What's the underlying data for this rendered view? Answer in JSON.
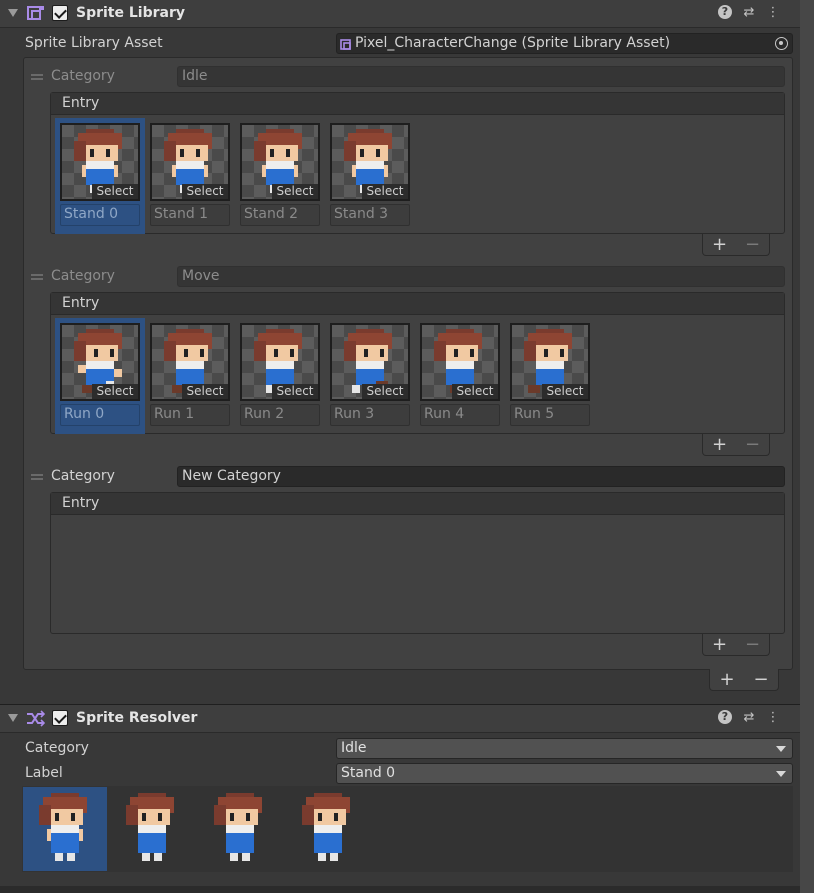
{
  "sprite_library": {
    "title": "Sprite Library",
    "asset_label": "Sprite Library Asset",
    "asset_value": "Pixel_CharacterChange (Sprite Library Asset)",
    "categories": [
      {
        "label": "Category",
        "name": "Idle",
        "entry_header": "Entry",
        "entries": [
          {
            "name": "Stand 0",
            "select": "Select"
          },
          {
            "name": "Stand 1",
            "select": "Select"
          },
          {
            "name": "Stand 2",
            "select": "Select"
          },
          {
            "name": "Stand 3",
            "select": "Select"
          }
        ]
      },
      {
        "label": "Category",
        "name": "Move",
        "entry_header": "Entry",
        "entries": [
          {
            "name": "Run 0",
            "select": "Select"
          },
          {
            "name": "Run 1",
            "select": "Select"
          },
          {
            "name": "Run 2",
            "select": "Select"
          },
          {
            "name": "Run 3",
            "select": "Select"
          },
          {
            "name": "Run 4",
            "select": "Select"
          },
          {
            "name": "Run 5",
            "select": "Select"
          }
        ]
      },
      {
        "label": "Category",
        "name": "New Category",
        "entry_header": "Entry",
        "entries": []
      }
    ],
    "add_symbol": "+",
    "remove_symbol": "−"
  },
  "sprite_resolver": {
    "title": "Sprite Resolver",
    "category_label": "Category",
    "category_value": "Idle",
    "label_label": "Label",
    "label_value": "Stand 0"
  },
  "icons": {
    "help": "?",
    "presets": "⇄",
    "more": "⋮"
  },
  "colors": {
    "selection": "#2d5183",
    "panel": "#383838",
    "accent_icon": "#a98be8"
  }
}
